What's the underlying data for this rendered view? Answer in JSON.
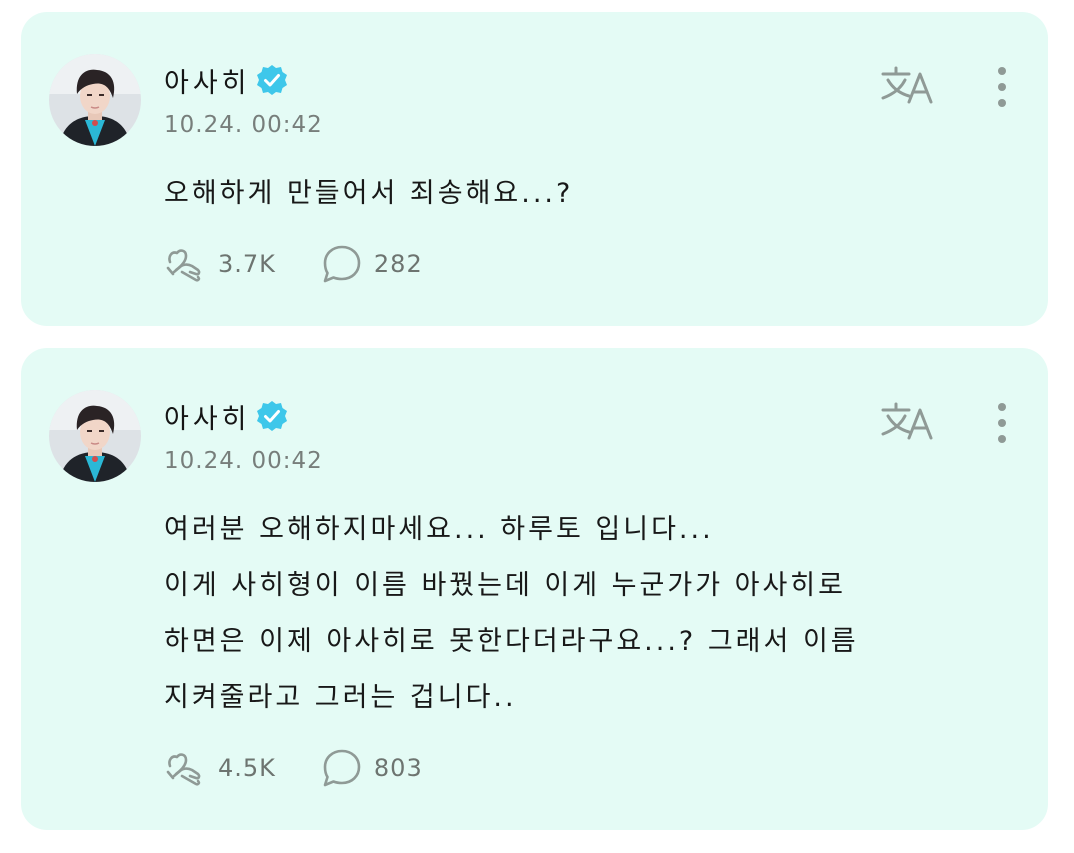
{
  "posts": [
    {
      "author": "아사히",
      "time": "10.24. 00:42",
      "text": "오해하게 만들어서 죄송해요...?",
      "likes": "3.7K",
      "comments": "282"
    },
    {
      "author": "아사히",
      "time": "10.24. 00:42",
      "text": "여러분 오해하지마세요... 하루토 입니다...\n이게 사히형이 이름 바꿨는데 이게 누군가가 아사히로\n하면은 이제 아사히로 못한다더라구요...? 그래서 이름\n지켜줄라고 그러는 겁니다..",
      "likes": "4.5K",
      "comments": "803"
    }
  ],
  "icons": {
    "verified": "verified-badge-icon",
    "translate": "translate-icon",
    "more": "more-vertical-icon",
    "like": "heart-hand-icon",
    "comment": "speech-bubble-icon"
  },
  "colors": {
    "card_background": "#e4fbf5",
    "verified": "#3ec7ea",
    "icon_gray": "#8f9a96",
    "meta_text": "#777e7b"
  }
}
